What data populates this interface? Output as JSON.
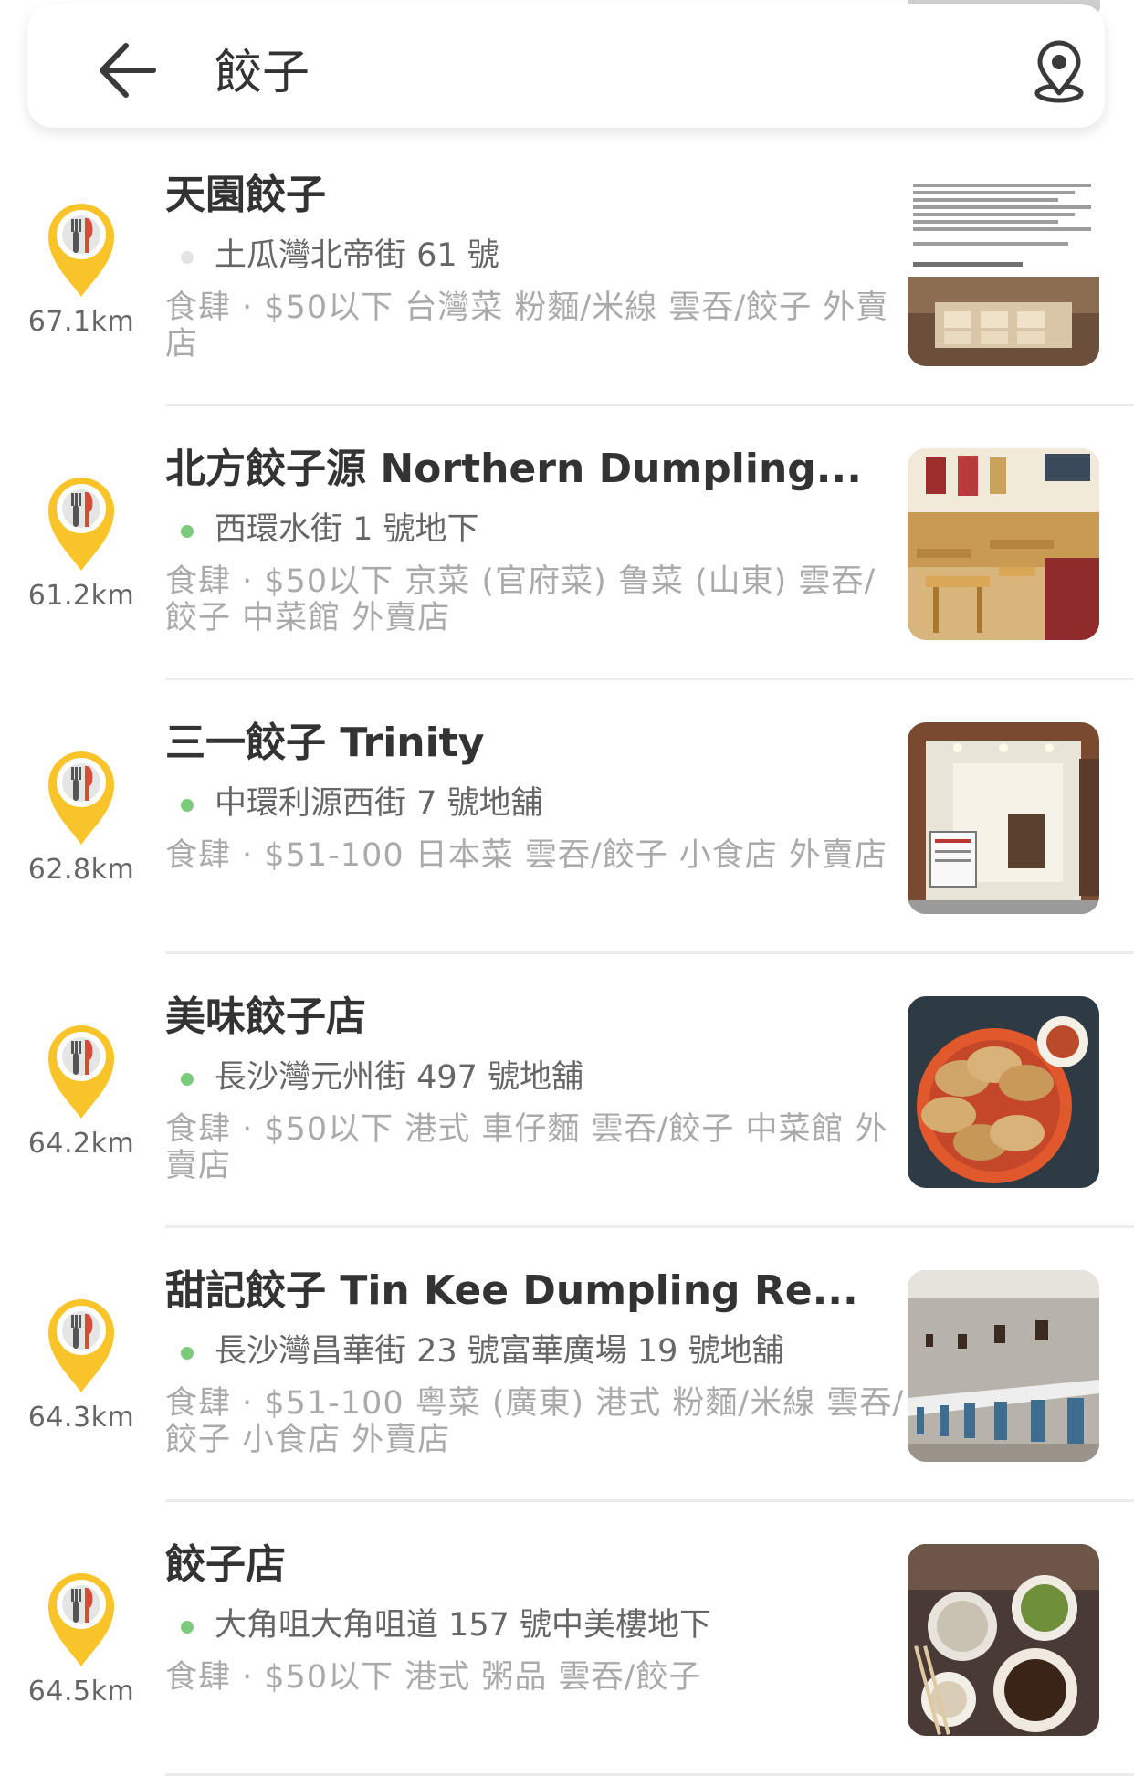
{
  "search": {
    "query": "餃子"
  },
  "colors": {
    "pin_yellow": "#F8C42A",
    "dot_closed": "#e4e4e4",
    "dot_open": "#7CCB7C"
  },
  "results": [
    {
      "name": "天園餃子",
      "address": "土瓜灣北帝街 61 號",
      "open": false,
      "tags": "食肆 · $50以下  台灣菜  粉麵/米線  雲吞/餃子  外賣店",
      "distance": "67.1km",
      "photo": "menu-notice-photo"
    },
    {
      "name": "北方餃子源 Northern Dumpling...",
      "address": "西環水街 1 號地下",
      "open": true,
      "tags": "食肆 · $50以下  京菜 (官府菜)  鲁菜 (山東)  雲吞/餃子  中菜館  外賣店",
      "distance": "61.2km",
      "photo": "restaurant-interior-photo"
    },
    {
      "name": "三一餃子 Trinity",
      "address": "中環利源西街 7 號地舖",
      "open": true,
      "tags": "食肆 · $51-100  日本菜  雲吞/餃子  小食店  外賣店",
      "distance": "62.8km",
      "photo": "shopfront-photo"
    },
    {
      "name": "美味餃子店",
      "address": "長沙灣元州街 497 號地舖",
      "open": true,
      "tags": "食肆 · $50以下  港式  車仔麵  雲吞/餃子  中菜館  外賣店",
      "distance": "64.2km",
      "photo": "fried-dumplings-photo"
    },
    {
      "name": "甜記餃子 Tin Kee Dumpling Re...",
      "address": "長沙灣昌華街 23 號富華廣場 19 號地舖",
      "open": true,
      "tags": "食肆 · $51-100  粵菜 (廣東)  港式  粉麵/米線  雲吞/餃子  小食店  外賣店",
      "distance": "64.3km",
      "photo": "long-counter-photo"
    },
    {
      "name": "餃子店",
      "address": "大角咀大角咀道 157 號中美樓地下",
      "open": true,
      "tags": "食肆 · $50以下  港式  粥品  雲吞/餃子",
      "distance": "64.5km",
      "photo": "dishes-table-photo"
    }
  ]
}
